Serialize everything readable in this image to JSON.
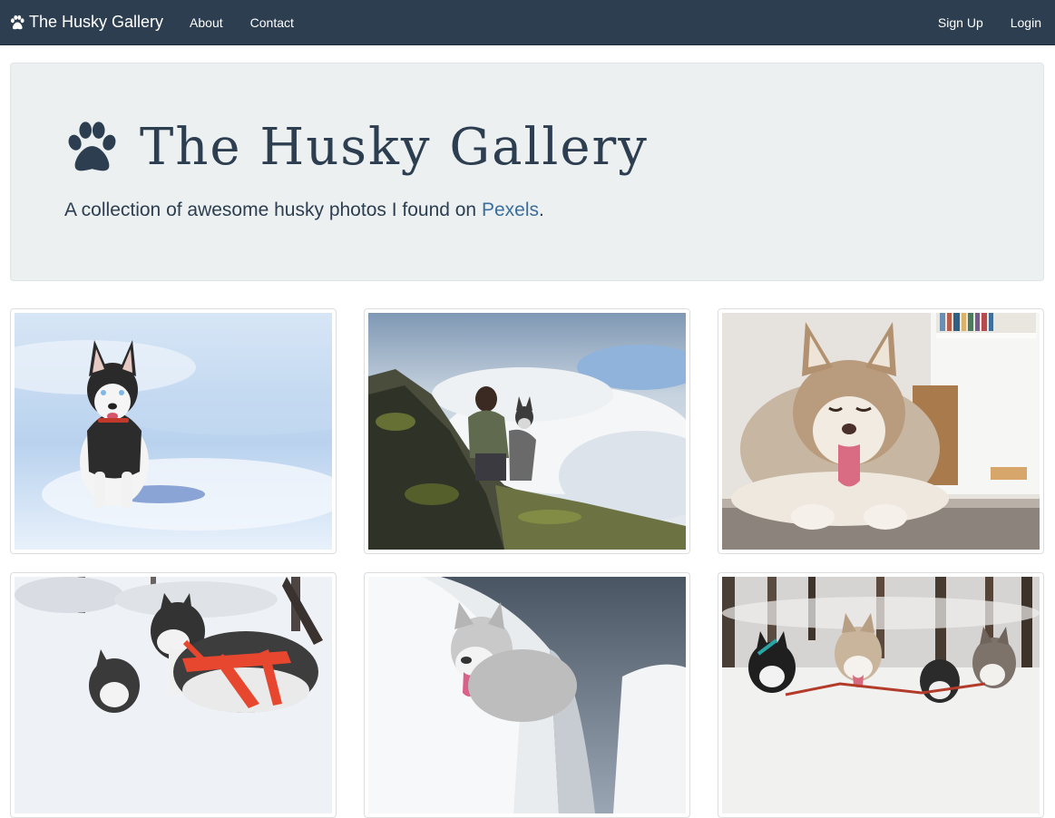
{
  "navbar": {
    "brand": "The Husky Gallery",
    "links": [
      "About",
      "Contact"
    ],
    "right_links": [
      "Sign Up",
      "Login"
    ]
  },
  "hero": {
    "title": "The Husky Gallery",
    "subtitle_prefix": "A collection of awesome husky photos I found on ",
    "subtitle_link": "Pexels",
    "subtitle_suffix": "."
  },
  "gallery": {
    "items": [
      {
        "name": "husky-puppy-snow-photo"
      },
      {
        "name": "woman-husky-mountain-photo"
      },
      {
        "name": "fluffy-husky-lying-photo"
      },
      {
        "name": "huskies-harness-snow-photo"
      },
      {
        "name": "husky-snow-cliff-photo"
      },
      {
        "name": "sled-dog-team-photo"
      }
    ]
  },
  "colors": {
    "navbar": "#2c3e50",
    "jumbotron": "#ecf0f1",
    "link": "#3a6e9c"
  }
}
